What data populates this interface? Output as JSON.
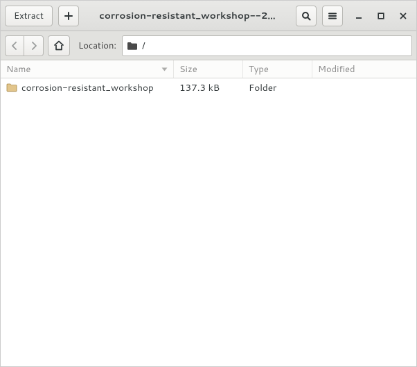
{
  "titlebar": {
    "extract_label": "Extract",
    "title": "corrosion-resistant_workshop--2…"
  },
  "navbar": {
    "location_label": "Location:",
    "path": "/"
  },
  "columns": {
    "name": "Name",
    "size": "Size",
    "type": "Type",
    "modified": "Modified"
  },
  "rows": [
    {
      "name": "corrosion-resistant_workshop",
      "size": "137.3 kB",
      "type": "Folder",
      "modified": ""
    }
  ]
}
